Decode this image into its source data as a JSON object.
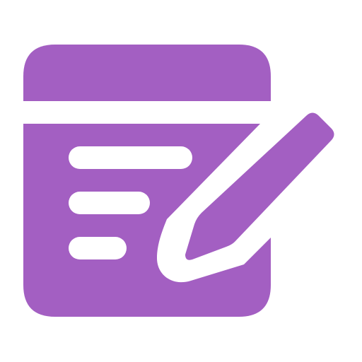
{
  "icon": {
    "name": "edit-note-icon",
    "color": "#A35FC2",
    "background": "#FFFFFF"
  }
}
